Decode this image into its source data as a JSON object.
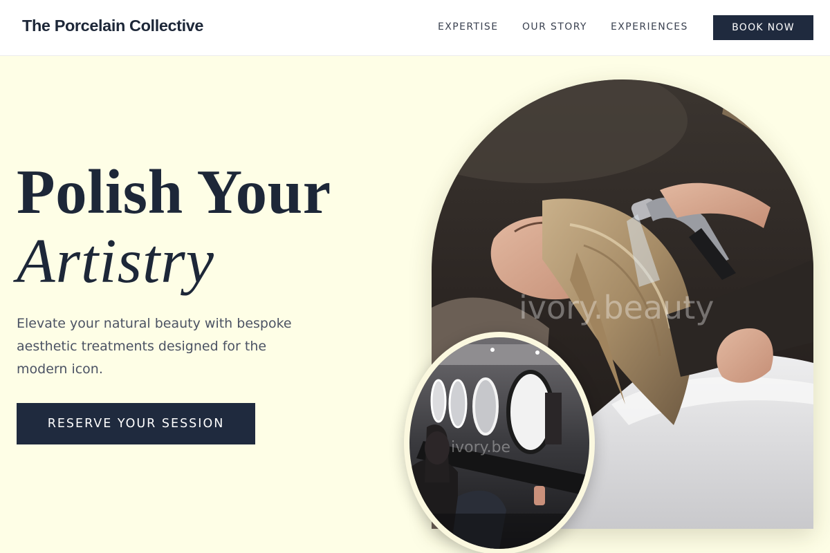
{
  "header": {
    "brand": "The Porcelain Collective",
    "nav": [
      "EXPERTISE",
      "OUR STORY",
      "EXPERIENCES"
    ],
    "book_button": "BOOK NOW"
  },
  "hero": {
    "title_line1": "Polish Your",
    "title_line2": "Artistry",
    "subtitle": "Elevate your natural beauty with bespoke aesthetic treatments designed for the modern icon.",
    "cta": "RESERVE YOUR SESSION"
  },
  "images": {
    "main_watermark": "ivory.beauty",
    "inset_watermark": "ivory.be"
  },
  "colors": {
    "background": "#fefee6",
    "navy": "#1f2a3e",
    "text_dark": "#1d2738",
    "text_muted": "#4b5263"
  }
}
